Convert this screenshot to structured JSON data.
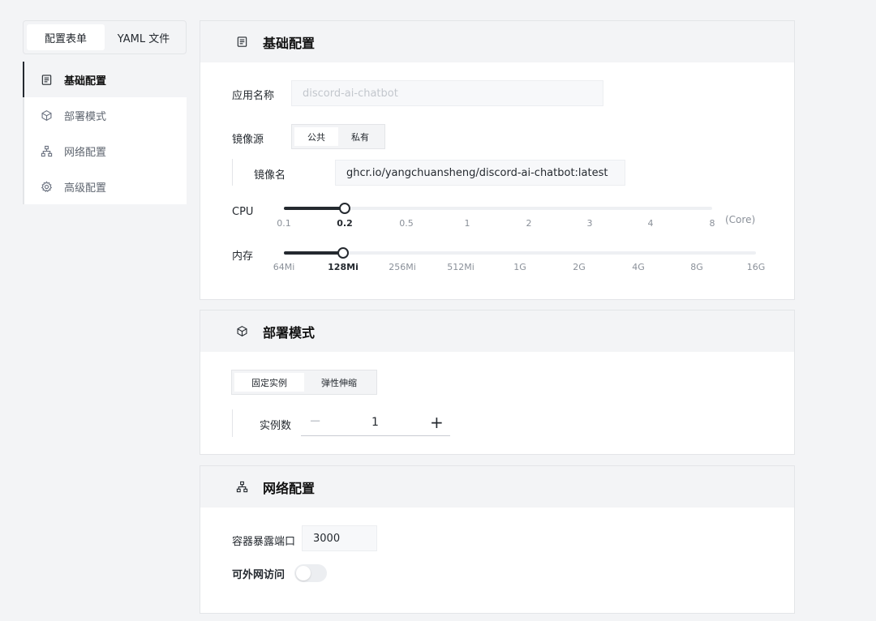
{
  "mode_tabs": {
    "form": "配置表单",
    "yaml": "YAML 文件"
  },
  "side_nav": {
    "items": [
      {
        "label": "基础配置",
        "icon": "document-icon"
      },
      {
        "label": "部署模式",
        "icon": "cube-icon"
      },
      {
        "label": "网络配置",
        "icon": "network-icon"
      },
      {
        "label": "高级配置",
        "icon": "gear-icon"
      }
    ],
    "active_index": 0
  },
  "basic": {
    "title": "基础配置",
    "app_name_label": "应用名称",
    "app_name_placeholder": "discord-ai-chatbot",
    "image_source_label": "镜像源",
    "image_source_options": [
      "公共",
      "私有"
    ],
    "image_source_selected": "公共",
    "image_name_label": "镜像名",
    "image_name_value": "ghcr.io/yangchuansheng/discord-ai-chatbot:latest",
    "cpu": {
      "label": "CPU",
      "ticks": [
        "0.1",
        "0.2",
        "0.5",
        "1",
        "2",
        "3",
        "4",
        "8"
      ],
      "selected": "0.2",
      "unit": "(Core)"
    },
    "memory": {
      "label": "内存",
      "ticks": [
        "64Mi",
        "128Mi",
        "256Mi",
        "512Mi",
        "1G",
        "2G",
        "4G",
        "8G",
        "16G"
      ],
      "selected": "128Mi"
    }
  },
  "deploy": {
    "title": "部署模式",
    "options": [
      "固定实例",
      "弹性伸缩"
    ],
    "selected": "固定实例",
    "instances_label": "实例数",
    "instances_value": "1",
    "minus": "−",
    "plus": "+"
  },
  "network": {
    "title": "网络配置",
    "port_label": "容器暴露端口",
    "port_value": "3000",
    "public_access_label": "可外网访问",
    "public_access_enabled": false
  },
  "colors": {
    "accent": "#24292f",
    "page_bg": "#f3f4f6",
    "panel_bg": "#ffffff"
  }
}
